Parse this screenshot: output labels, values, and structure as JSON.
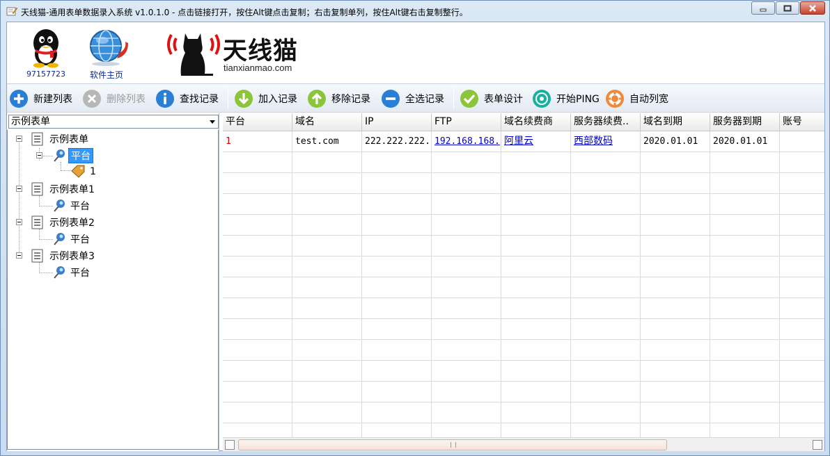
{
  "window": {
    "title": "天线猫-通用表单数据录入系统 v1.0.1.0 - 点击链接打开，按住Alt键点击复制；右击复制单列，按住Alt键右击复制整行。"
  },
  "header": {
    "qq_label": "97157723",
    "homepage_label": "软件主页",
    "logo_name": "天线猫",
    "logo_url": "tianxianmao.com"
  },
  "toolbar": {
    "new_list": "新建列表",
    "delete_list": "删除列表",
    "find_record": "查找记录",
    "add_record": "加入记录",
    "remove_record": "移除记录",
    "select_all": "全选记录",
    "form_design": "表单设计",
    "start_ping": "开始PING",
    "auto_width": "自动列宽"
  },
  "left_panel": {
    "combo_value": "示例表单",
    "tree": [
      {
        "label": "示例表单",
        "child": "平台",
        "grandchild": "1"
      },
      {
        "label": "示例表单1",
        "child": "平台"
      },
      {
        "label": "示例表单2",
        "child": "平台"
      },
      {
        "label": "示例表单3",
        "child": "平台"
      }
    ]
  },
  "grid": {
    "columns": [
      "平台",
      "域名",
      "IP",
      "FTP",
      "域名续费商",
      "服务器续费..",
      "域名到期",
      "服务器到期",
      "账号"
    ],
    "rows": [
      [
        "1",
        "test.com",
        "222.222.222.",
        "192.168.168.",
        "阿里云",
        "西部数码",
        "2020.01.01",
        "2020.01.01",
        ""
      ]
    ]
  },
  "colors": {
    "accent": "#3399ff",
    "link": "#0000cc",
    "first_cell": "#cc0000"
  }
}
